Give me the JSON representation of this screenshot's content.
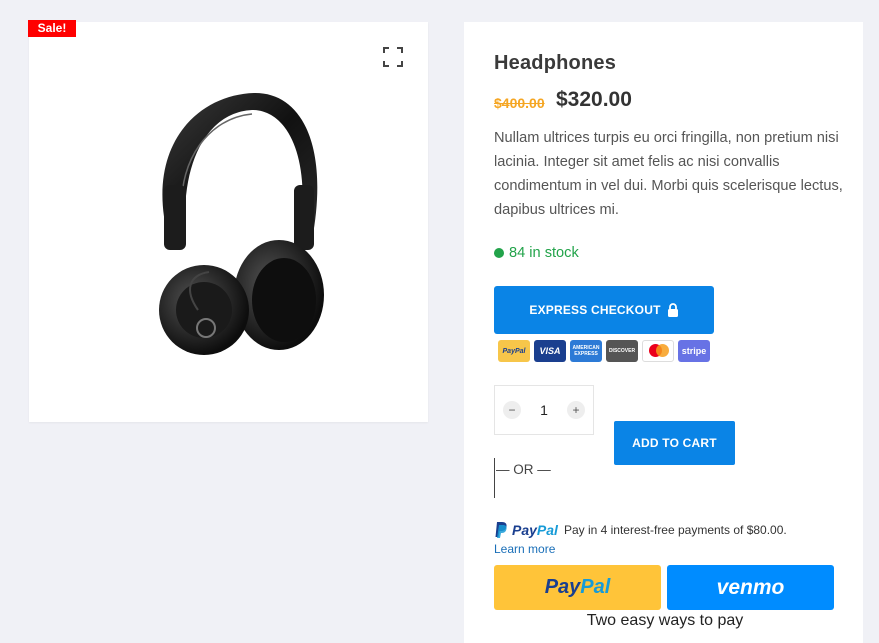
{
  "badge": {
    "sale": "Sale!"
  },
  "gallery": {
    "fullscreen_icon": "fullscreen-icon",
    "image_alt": "headphones-image"
  },
  "product": {
    "title": "Headphones",
    "price_old": "$400.00",
    "price_new": "$320.00",
    "description": "Nullam ultrices turpis eu orci fringilla, non pretium nisi lacinia. Integer sit amet felis ac nisi convallis condimentum in vel dui. Morbi quis scelerisque lectus, dapibus ultrices mi.",
    "stock": "84 in stock"
  },
  "checkout": {
    "express_label": "EXPRESS CHECKOUT",
    "payment_icons": [
      {
        "name": "PayPal",
        "text": "PayPal"
      },
      {
        "name": "VISA",
        "text": "VISA"
      },
      {
        "name": "American Express",
        "text": "AMERICAN EXPRESS"
      },
      {
        "name": "Discover",
        "text": "DISCOVER"
      },
      {
        "name": "Mastercard",
        "text": ""
      },
      {
        "name": "stripe",
        "text": "stripe"
      }
    ]
  },
  "cart": {
    "qty_minus": "−",
    "qty_value": "1",
    "qty_plus": "+",
    "add_label": "ADD TO CART",
    "or_label": "— OR —"
  },
  "paypal": {
    "logo_dark": "Pay",
    "logo_light": "Pal",
    "message": "Pay in 4 interest-free payments of $80.00.",
    "learn_more": "Learn more",
    "venmo_label": "venmo",
    "two_ways": "Two easy ways to pay"
  },
  "colors": {
    "accent": "#0a84e6",
    "sale": "#ff0000",
    "stock": "#22a34a",
    "price_old": "#f5a623",
    "paypal_yellow": "#ffc439",
    "venmo_blue": "#008cff"
  }
}
